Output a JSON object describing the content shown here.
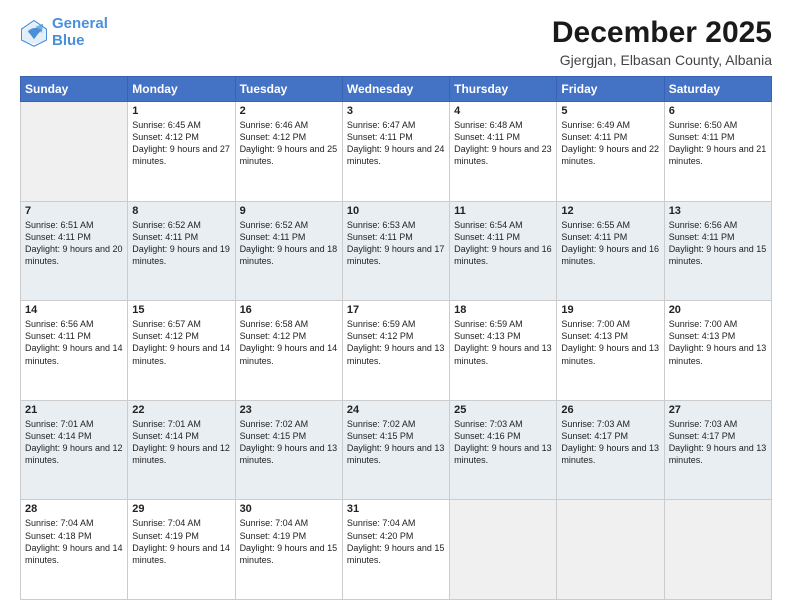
{
  "logo": {
    "line1": "General",
    "line2": "Blue"
  },
  "title": "December 2025",
  "location": "Gjergjan, Elbasan County, Albania",
  "days_of_week": [
    "Sunday",
    "Monday",
    "Tuesday",
    "Wednesday",
    "Thursday",
    "Friday",
    "Saturday"
  ],
  "weeks": [
    [
      {
        "day": "",
        "sunrise": "",
        "sunset": "",
        "daylight": "",
        "empty": true
      },
      {
        "day": "1",
        "sunrise": "Sunrise: 6:45 AM",
        "sunset": "Sunset: 4:12 PM",
        "daylight": "Daylight: 9 hours and 27 minutes."
      },
      {
        "day": "2",
        "sunrise": "Sunrise: 6:46 AM",
        "sunset": "Sunset: 4:12 PM",
        "daylight": "Daylight: 9 hours and 25 minutes."
      },
      {
        "day": "3",
        "sunrise": "Sunrise: 6:47 AM",
        "sunset": "Sunset: 4:11 PM",
        "daylight": "Daylight: 9 hours and 24 minutes."
      },
      {
        "day": "4",
        "sunrise": "Sunrise: 6:48 AM",
        "sunset": "Sunset: 4:11 PM",
        "daylight": "Daylight: 9 hours and 23 minutes."
      },
      {
        "day": "5",
        "sunrise": "Sunrise: 6:49 AM",
        "sunset": "Sunset: 4:11 PM",
        "daylight": "Daylight: 9 hours and 22 minutes."
      },
      {
        "day": "6",
        "sunrise": "Sunrise: 6:50 AM",
        "sunset": "Sunset: 4:11 PM",
        "daylight": "Daylight: 9 hours and 21 minutes."
      }
    ],
    [
      {
        "day": "7",
        "sunrise": "Sunrise: 6:51 AM",
        "sunset": "Sunset: 4:11 PM",
        "daylight": "Daylight: 9 hours and 20 minutes."
      },
      {
        "day": "8",
        "sunrise": "Sunrise: 6:52 AM",
        "sunset": "Sunset: 4:11 PM",
        "daylight": "Daylight: 9 hours and 19 minutes."
      },
      {
        "day": "9",
        "sunrise": "Sunrise: 6:52 AM",
        "sunset": "Sunset: 4:11 PM",
        "daylight": "Daylight: 9 hours and 18 minutes."
      },
      {
        "day": "10",
        "sunrise": "Sunrise: 6:53 AM",
        "sunset": "Sunset: 4:11 PM",
        "daylight": "Daylight: 9 hours and 17 minutes."
      },
      {
        "day": "11",
        "sunrise": "Sunrise: 6:54 AM",
        "sunset": "Sunset: 4:11 PM",
        "daylight": "Daylight: 9 hours and 16 minutes."
      },
      {
        "day": "12",
        "sunrise": "Sunrise: 6:55 AM",
        "sunset": "Sunset: 4:11 PM",
        "daylight": "Daylight: 9 hours and 16 minutes."
      },
      {
        "day": "13",
        "sunrise": "Sunrise: 6:56 AM",
        "sunset": "Sunset: 4:11 PM",
        "daylight": "Daylight: 9 hours and 15 minutes."
      }
    ],
    [
      {
        "day": "14",
        "sunrise": "Sunrise: 6:56 AM",
        "sunset": "Sunset: 4:11 PM",
        "daylight": "Daylight: 9 hours and 14 minutes."
      },
      {
        "day": "15",
        "sunrise": "Sunrise: 6:57 AM",
        "sunset": "Sunset: 4:12 PM",
        "daylight": "Daylight: 9 hours and 14 minutes."
      },
      {
        "day": "16",
        "sunrise": "Sunrise: 6:58 AM",
        "sunset": "Sunset: 4:12 PM",
        "daylight": "Daylight: 9 hours and 14 minutes."
      },
      {
        "day": "17",
        "sunrise": "Sunrise: 6:59 AM",
        "sunset": "Sunset: 4:12 PM",
        "daylight": "Daylight: 9 hours and 13 minutes."
      },
      {
        "day": "18",
        "sunrise": "Sunrise: 6:59 AM",
        "sunset": "Sunset: 4:13 PM",
        "daylight": "Daylight: 9 hours and 13 minutes."
      },
      {
        "day": "19",
        "sunrise": "Sunrise: 7:00 AM",
        "sunset": "Sunset: 4:13 PM",
        "daylight": "Daylight: 9 hours and 13 minutes."
      },
      {
        "day": "20",
        "sunrise": "Sunrise: 7:00 AM",
        "sunset": "Sunset: 4:13 PM",
        "daylight": "Daylight: 9 hours and 13 minutes."
      }
    ],
    [
      {
        "day": "21",
        "sunrise": "Sunrise: 7:01 AM",
        "sunset": "Sunset: 4:14 PM",
        "daylight": "Daylight: 9 hours and 12 minutes."
      },
      {
        "day": "22",
        "sunrise": "Sunrise: 7:01 AM",
        "sunset": "Sunset: 4:14 PM",
        "daylight": "Daylight: 9 hours and 12 minutes."
      },
      {
        "day": "23",
        "sunrise": "Sunrise: 7:02 AM",
        "sunset": "Sunset: 4:15 PM",
        "daylight": "Daylight: 9 hours and 13 minutes."
      },
      {
        "day": "24",
        "sunrise": "Sunrise: 7:02 AM",
        "sunset": "Sunset: 4:15 PM",
        "daylight": "Daylight: 9 hours and 13 minutes."
      },
      {
        "day": "25",
        "sunrise": "Sunrise: 7:03 AM",
        "sunset": "Sunset: 4:16 PM",
        "daylight": "Daylight: 9 hours and 13 minutes."
      },
      {
        "day": "26",
        "sunrise": "Sunrise: 7:03 AM",
        "sunset": "Sunset: 4:17 PM",
        "daylight": "Daylight: 9 hours and 13 minutes."
      },
      {
        "day": "27",
        "sunrise": "Sunrise: 7:03 AM",
        "sunset": "Sunset: 4:17 PM",
        "daylight": "Daylight: 9 hours and 13 minutes."
      }
    ],
    [
      {
        "day": "28",
        "sunrise": "Sunrise: 7:04 AM",
        "sunset": "Sunset: 4:18 PM",
        "daylight": "Daylight: 9 hours and 14 minutes."
      },
      {
        "day": "29",
        "sunrise": "Sunrise: 7:04 AM",
        "sunset": "Sunset: 4:19 PM",
        "daylight": "Daylight: 9 hours and 14 minutes."
      },
      {
        "day": "30",
        "sunrise": "Sunrise: 7:04 AM",
        "sunset": "Sunset: 4:19 PM",
        "daylight": "Daylight: 9 hours and 15 minutes."
      },
      {
        "day": "31",
        "sunrise": "Sunrise: 7:04 AM",
        "sunset": "Sunset: 4:20 PM",
        "daylight": "Daylight: 9 hours and 15 minutes."
      },
      {
        "day": "",
        "sunrise": "",
        "sunset": "",
        "daylight": "",
        "empty": true
      },
      {
        "day": "",
        "sunrise": "",
        "sunset": "",
        "daylight": "",
        "empty": true
      },
      {
        "day": "",
        "sunrise": "",
        "sunset": "",
        "daylight": "",
        "empty": true
      }
    ]
  ]
}
